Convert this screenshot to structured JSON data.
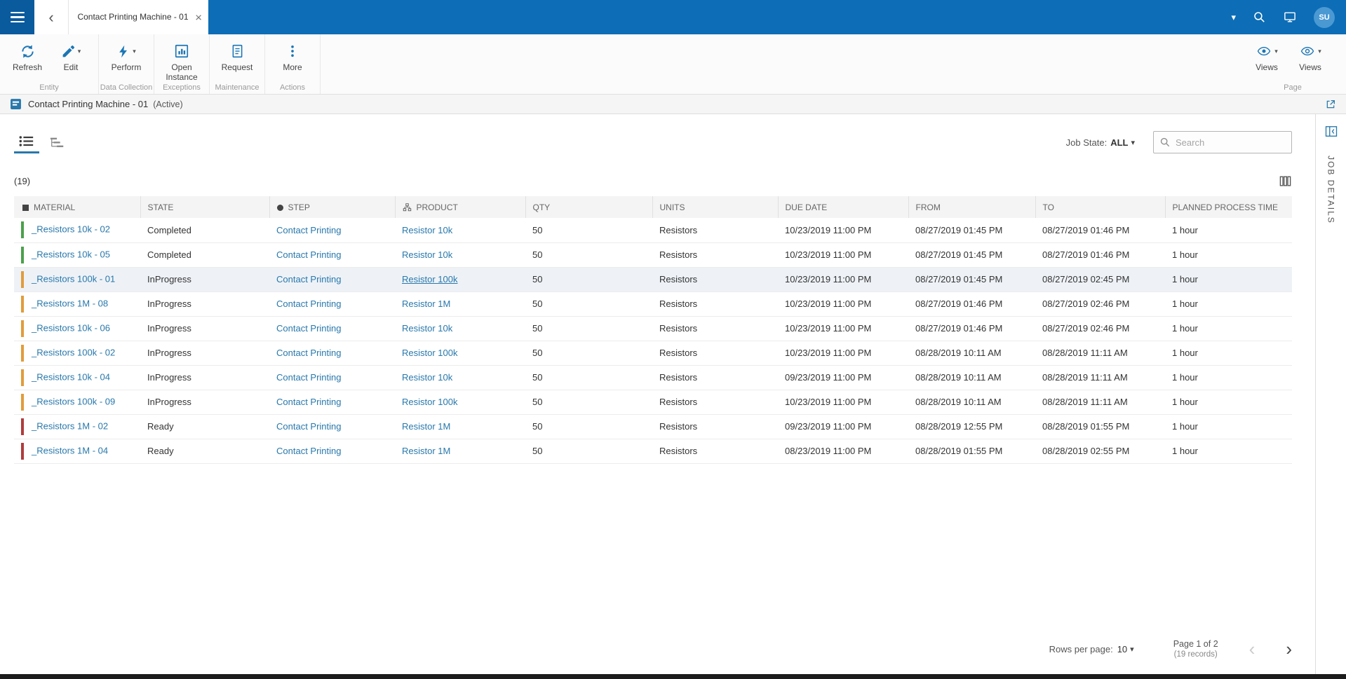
{
  "colors": {
    "topbar": "#0d6db6",
    "accent": "#1b76b6",
    "link": "#2878ab",
    "state_completed": "#4ca04c",
    "state_inprogress": "#e09c3c",
    "state_ready": "#b03c3c"
  },
  "glyphs": {
    "caret_down": "▾",
    "chevron_left": "‹",
    "chevron_right": "›",
    "close": "×"
  },
  "topbar": {
    "tab_title": "Contact Printing Machine - 01",
    "avatar": "SU"
  },
  "ribbon": {
    "refresh": "Refresh",
    "edit": "Edit",
    "perform": "Perform",
    "open_instance": "Open Instance",
    "request": "Request",
    "more": "More",
    "views1": "Views",
    "views2": "Views",
    "groups": {
      "entity": "Entity",
      "data_collection": "Data Collection",
      "exceptions": "Exceptions",
      "maintenance": "Maintenance",
      "actions": "Actions",
      "page": "Page"
    }
  },
  "entity_header": {
    "title": "Contact Printing Machine - 01",
    "status": "(Active)"
  },
  "filters": {
    "job_state_label": "Job State:",
    "job_state_value": "ALL",
    "search_placeholder": "Search"
  },
  "panel": {
    "title": "JOB DETAILS"
  },
  "table": {
    "count": "(19)",
    "columns": [
      "MATERIAL",
      "STATE",
      "STEP",
      "PRODUCT",
      "QTY",
      "UNITS",
      "DUE DATE",
      "FROM",
      "TO",
      "PLANNED PROCESS TIME"
    ],
    "rows": [
      {
        "material": "_Resistors 10k - 02",
        "state": "Completed",
        "step": "Contact Printing",
        "product": "Resistor 10k",
        "qty": "50",
        "units": "Resistors",
        "due_date": "10/23/2019 11:00 PM",
        "from": "08/27/2019 01:45 PM",
        "to": "08/27/2019 01:46 PM",
        "planned_time": "1 hour",
        "bar_color": "#4ca04c",
        "selected": false,
        "product_underline": false
      },
      {
        "material": "_Resistors 10k - 05",
        "state": "Completed",
        "step": "Contact Printing",
        "product": "Resistor 10k",
        "qty": "50",
        "units": "Resistors",
        "due_date": "10/23/2019 11:00 PM",
        "from": "08/27/2019 01:45 PM",
        "to": "08/27/2019 01:46 PM",
        "planned_time": "1 hour",
        "bar_color": "#4ca04c",
        "selected": false,
        "product_underline": false
      },
      {
        "material": "_Resistors 100k - 01",
        "state": "InProgress",
        "step": "Contact Printing",
        "product": "Resistor 100k",
        "qty": "50",
        "units": "Resistors",
        "due_date": "10/23/2019 11:00 PM",
        "from": "08/27/2019 01:45 PM",
        "to": "08/27/2019 02:45 PM",
        "planned_time": "1 hour",
        "bar_color": "#e09c3c",
        "selected": true,
        "product_underline": true
      },
      {
        "material": "_Resistors 1M - 08",
        "state": "InProgress",
        "step": "Contact Printing",
        "product": "Resistor 1M",
        "qty": "50",
        "units": "Resistors",
        "due_date": "10/23/2019 11:00 PM",
        "from": "08/27/2019 01:46 PM",
        "to": "08/27/2019 02:46 PM",
        "planned_time": "1 hour",
        "bar_color": "#e09c3c",
        "selected": false,
        "product_underline": false
      },
      {
        "material": "_Resistors 10k - 06",
        "state": "InProgress",
        "step": "Contact Printing",
        "product": "Resistor 10k",
        "qty": "50",
        "units": "Resistors",
        "due_date": "10/23/2019 11:00 PM",
        "from": "08/27/2019 01:46 PM",
        "to": "08/27/2019 02:46 PM",
        "planned_time": "1 hour",
        "bar_color": "#e09c3c",
        "selected": false,
        "product_underline": false
      },
      {
        "material": "_Resistors 100k - 02",
        "state": "InProgress",
        "step": "Contact Printing",
        "product": "Resistor 100k",
        "qty": "50",
        "units": "Resistors",
        "due_date": "10/23/2019 11:00 PM",
        "from": "08/28/2019 10:11 AM",
        "to": "08/28/2019 11:11 AM",
        "planned_time": "1 hour",
        "bar_color": "#e09c3c",
        "selected": false,
        "product_underline": false
      },
      {
        "material": "_Resistors 10k - 04",
        "state": "InProgress",
        "step": "Contact Printing",
        "product": "Resistor 10k",
        "qty": "50",
        "units": "Resistors",
        "due_date": "09/23/2019 11:00 PM",
        "from": "08/28/2019 10:11 AM",
        "to": "08/28/2019 11:11 AM",
        "planned_time": "1 hour",
        "bar_color": "#e09c3c",
        "selected": false,
        "product_underline": false
      },
      {
        "material": "_Resistors 100k - 09",
        "state": "InProgress",
        "step": "Contact Printing",
        "product": "Resistor 100k",
        "qty": "50",
        "units": "Resistors",
        "due_date": "10/23/2019 11:00 PM",
        "from": "08/28/2019 10:11 AM",
        "to": "08/28/2019 11:11 AM",
        "planned_time": "1 hour",
        "bar_color": "#e09c3c",
        "selected": false,
        "product_underline": false
      },
      {
        "material": "_Resistors 1M - 02",
        "state": "Ready",
        "step": "Contact Printing",
        "product": "Resistor 1M",
        "qty": "50",
        "units": "Resistors",
        "due_date": "09/23/2019 11:00 PM",
        "from": "08/28/2019 12:55 PM",
        "to": "08/28/2019 01:55 PM",
        "planned_time": "1 hour",
        "bar_color": "#b03c3c",
        "selected": false,
        "product_underline": false
      },
      {
        "material": "_Resistors 1M - 04",
        "state": "Ready",
        "step": "Contact Printing",
        "product": "Resistor 1M",
        "qty": "50",
        "units": "Resistors",
        "due_date": "08/23/2019 11:00 PM",
        "from": "08/28/2019 01:55 PM",
        "to": "08/28/2019 02:55 PM",
        "planned_time": "1 hour",
        "bar_color": "#b03c3c",
        "selected": false,
        "product_underline": false
      }
    ]
  },
  "pagination": {
    "rows_per_page_label": "Rows per page:",
    "rows_per_page_value": "10",
    "page_info": "Page 1 of 2",
    "records_info": "(19 records)"
  }
}
